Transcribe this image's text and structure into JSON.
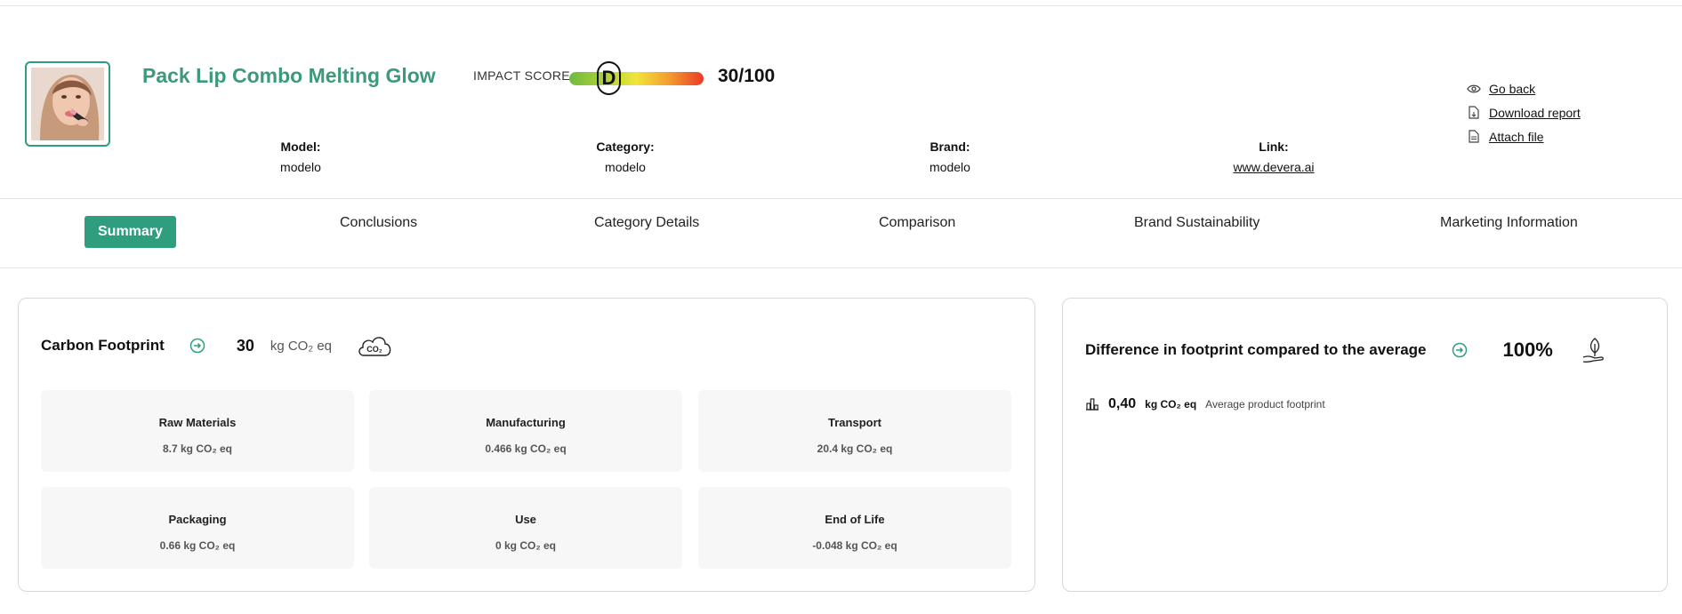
{
  "product": {
    "title": "Pack Lip Combo Melting Glow",
    "impact_label": "IMPACT SCORE",
    "impact_grade": "D",
    "impact_score": "30/100",
    "impact_score_value": 30,
    "meta": [
      {
        "key": "Model:",
        "value": "modelo"
      },
      {
        "key": "Category:",
        "value": "modelo"
      },
      {
        "key": "Brand:",
        "value": "modelo"
      },
      {
        "key": "Link:",
        "value": "www.devera.ai"
      }
    ]
  },
  "actions": {
    "go_back": "Go back",
    "download_report": "Download report",
    "attach_file": "Attach file"
  },
  "tabs": [
    {
      "label": "Summary",
      "active": true
    },
    {
      "label": "Conclusions"
    },
    {
      "label": "Category Details"
    },
    {
      "label": "Comparison"
    },
    {
      "label": "Brand Sustainability"
    },
    {
      "label": "Marketing Information"
    }
  ],
  "carbon": {
    "title": "Carbon Footprint",
    "value": "30",
    "unit": "kg CO₂ eq",
    "icon_label": "CO₂",
    "tiles": [
      {
        "title": "Raw Materials",
        "value": "8.7 kg CO₂ eq"
      },
      {
        "title": "Manufacturing",
        "value": "0.466 kg CO₂ eq"
      },
      {
        "title": "Transport",
        "value": "20.4 kg CO₂ eq"
      },
      {
        "title": "Packaging",
        "value": "0.66 kg CO₂ eq"
      },
      {
        "title": "Use",
        "value": "0 kg CO₂ eq"
      },
      {
        "title": "End of Life",
        "value": "-0.048 kg CO₂ eq"
      }
    ]
  },
  "difference": {
    "title": "Difference in footprint compared to the average",
    "percent": "100%",
    "avg_value": "0,40",
    "avg_unit": "kg CO₂ eq",
    "avg_desc": "Average product footprint"
  },
  "colors": {
    "brand": "#2f9e7f",
    "title_green": "#3d9a78",
    "tile_bg": "#f7f7f7"
  },
  "icons": [
    "product-photo",
    "eye-icon",
    "file-download-icon",
    "file-icon",
    "circle-arrow-icon",
    "co2-cloud-icon",
    "plant-hand-icon",
    "bar-chart-icon"
  ]
}
